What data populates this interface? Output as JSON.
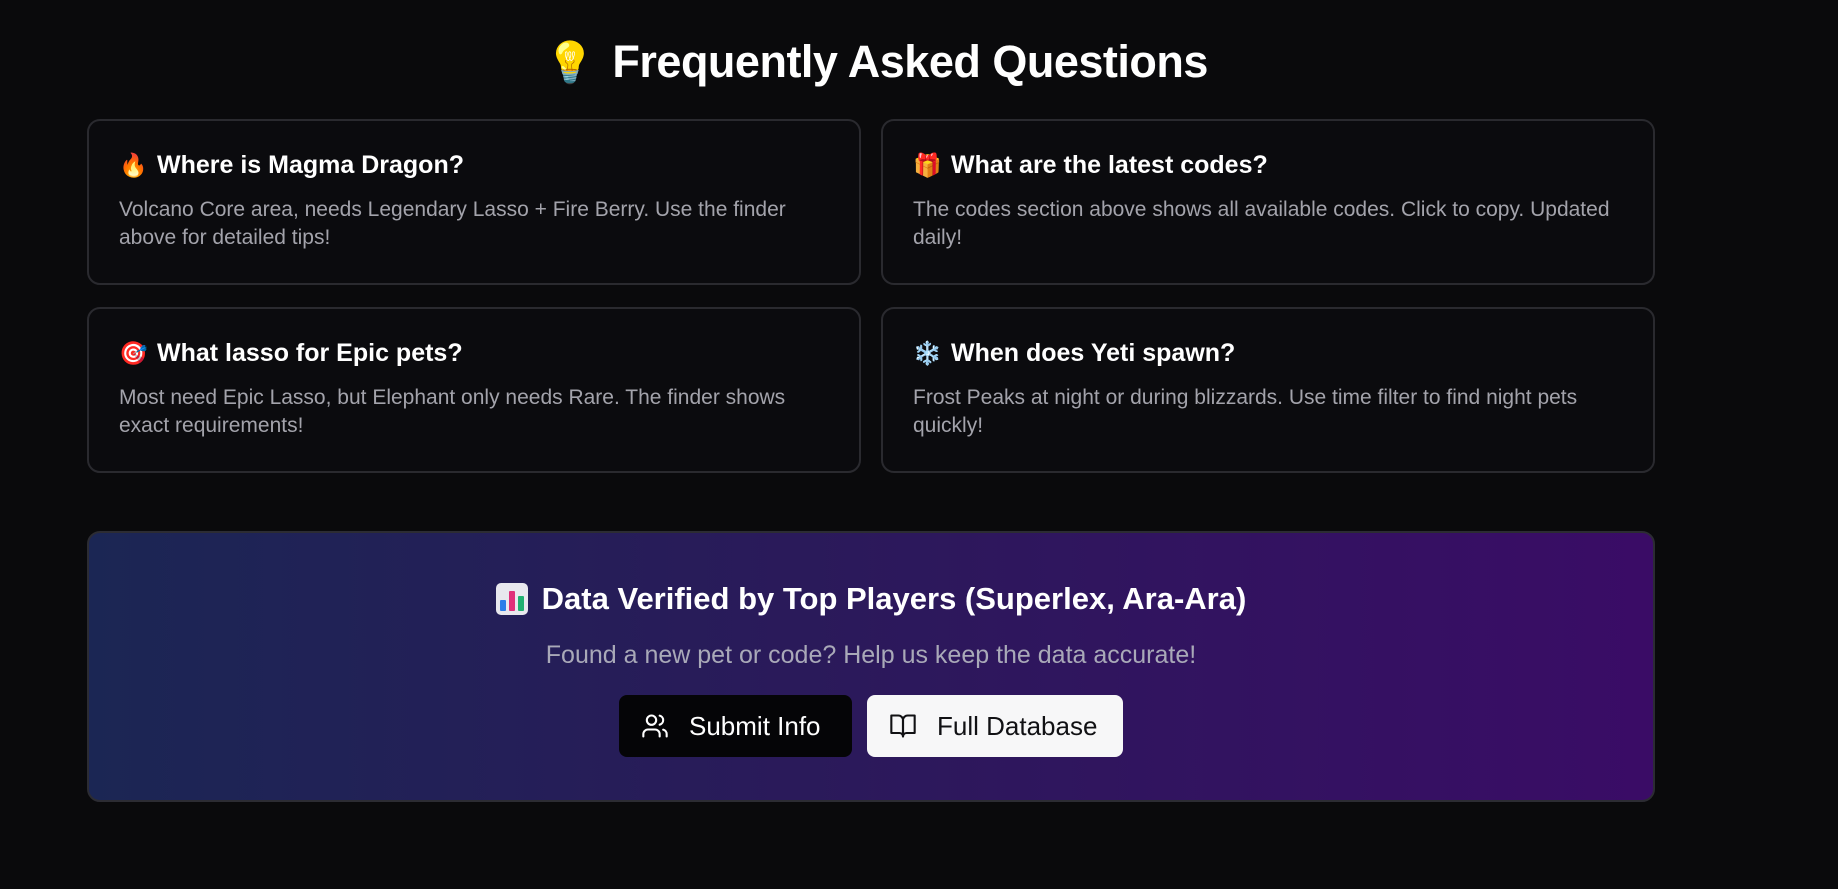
{
  "faq": {
    "title_icon": "lightbulb-icon",
    "title_emoji": "💡",
    "title": "Frequently Asked Questions",
    "items": [
      {
        "icon": "fire-icon",
        "emoji": "🔥",
        "question": "Where is Magma Dragon?",
        "answer": "Volcano Core area, needs Legendary Lasso + Fire Berry. Use the finder above for detailed tips!"
      },
      {
        "icon": "gift-icon",
        "emoji": "🎁",
        "question": "What are the latest codes?",
        "answer": "The codes section above shows all available codes. Click to copy. Updated daily!"
      },
      {
        "icon": "target-icon",
        "emoji": "🎯",
        "question": "What lasso for Epic pets?",
        "answer": "Most need Epic Lasso, but Elephant only needs Rare. The finder shows exact requirements!"
      },
      {
        "icon": "snowflake-icon",
        "emoji": "❄️",
        "question": "When does Yeti spawn?",
        "answer": "Frost Peaks at night or during blizzards. Use time filter to find night pets quickly!"
      }
    ]
  },
  "cta": {
    "icon": "bar-chart-icon",
    "title": "Data Verified by Top Players (Superlex, Ara-Ara)",
    "subtitle": "Found a new pet or code? Help us keep the data accurate!",
    "submit_label": "Submit Info",
    "submit_icon": "users-icon",
    "database_label": "Full Database",
    "database_icon": "book-open-icon"
  },
  "colors": {
    "background": "#0a0a0c",
    "card_border": "#2a2a2f",
    "gradient_start": "#1b2654",
    "gradient_end": "#3a0c66"
  }
}
